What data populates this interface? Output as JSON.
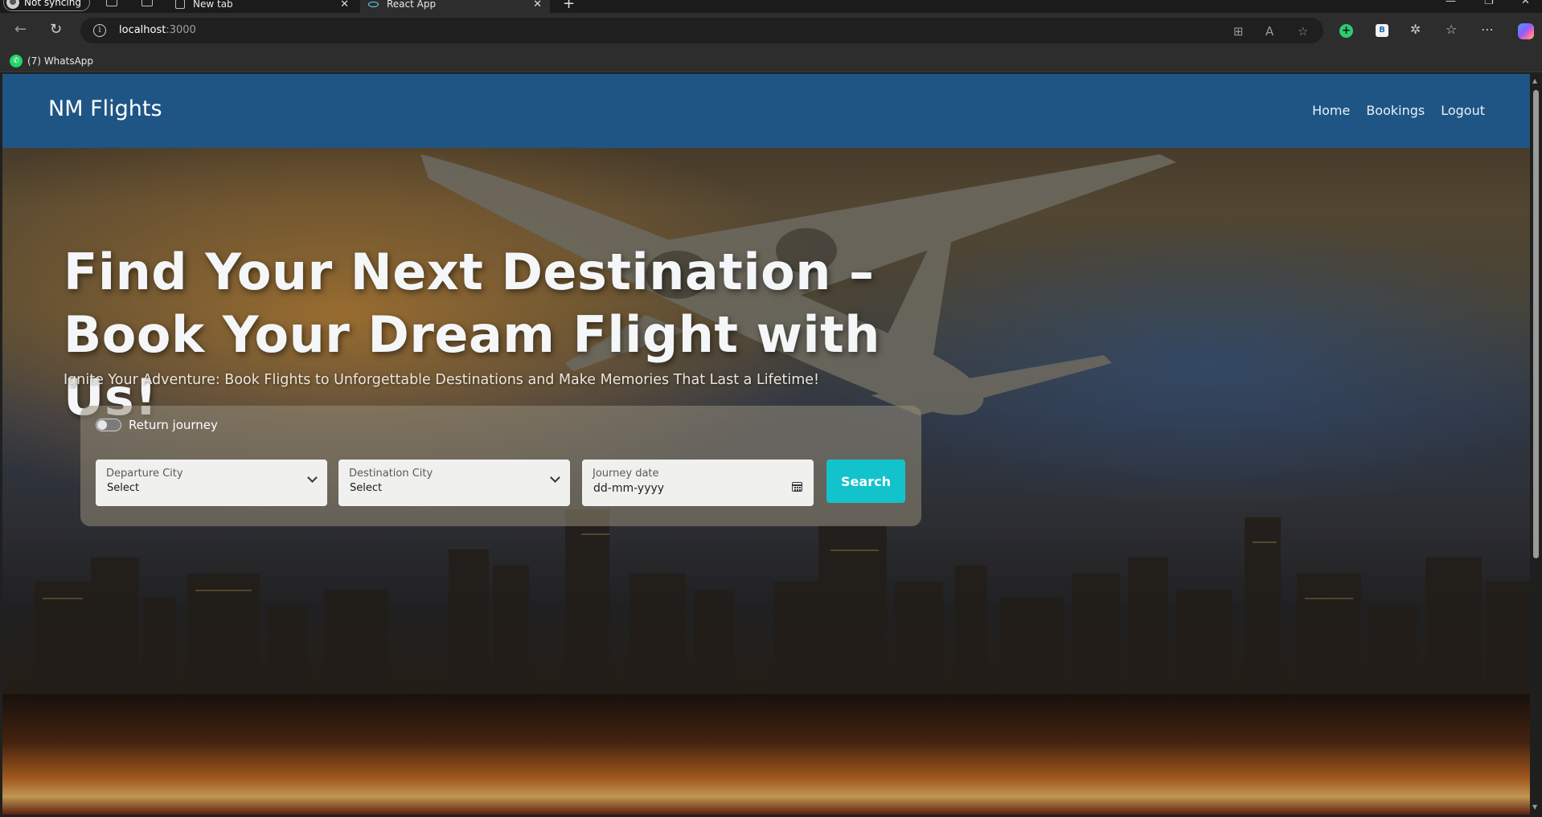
{
  "browser": {
    "profile_label": "Not syncing",
    "tabs": [
      {
        "title": "New tab",
        "favicon": "page-icon"
      },
      {
        "title": "React App",
        "favicon": "react-icon"
      }
    ],
    "address": {
      "host": "localhost",
      "port": ":3000"
    },
    "bookmarks": [
      {
        "label": "(7) WhatsApp",
        "icon": "whatsapp-icon"
      }
    ]
  },
  "site": {
    "brand": "NM Flights",
    "nav": {
      "home": "Home",
      "bookings": "Bookings",
      "logout": "Logout"
    },
    "colors": {
      "navbar": "#1e5585",
      "search_button": "#12c3cc"
    }
  },
  "hero": {
    "title": "Find Your Next Destination – Book Your Dream Flight with Us!",
    "subtitle": "Ignite Your Adventure: Book Flights to Unforgettable Destinations and Make Memories That Last a Lifetime!"
  },
  "search": {
    "return_toggle_label": "Return journey",
    "return_toggle_on": false,
    "departure": {
      "label": "Departure City",
      "value": "Select"
    },
    "destination": {
      "label": "Destination City",
      "value": "Select"
    },
    "date": {
      "label": "Journey date",
      "value": "dd-mm-yyyy"
    },
    "button": "Search"
  }
}
